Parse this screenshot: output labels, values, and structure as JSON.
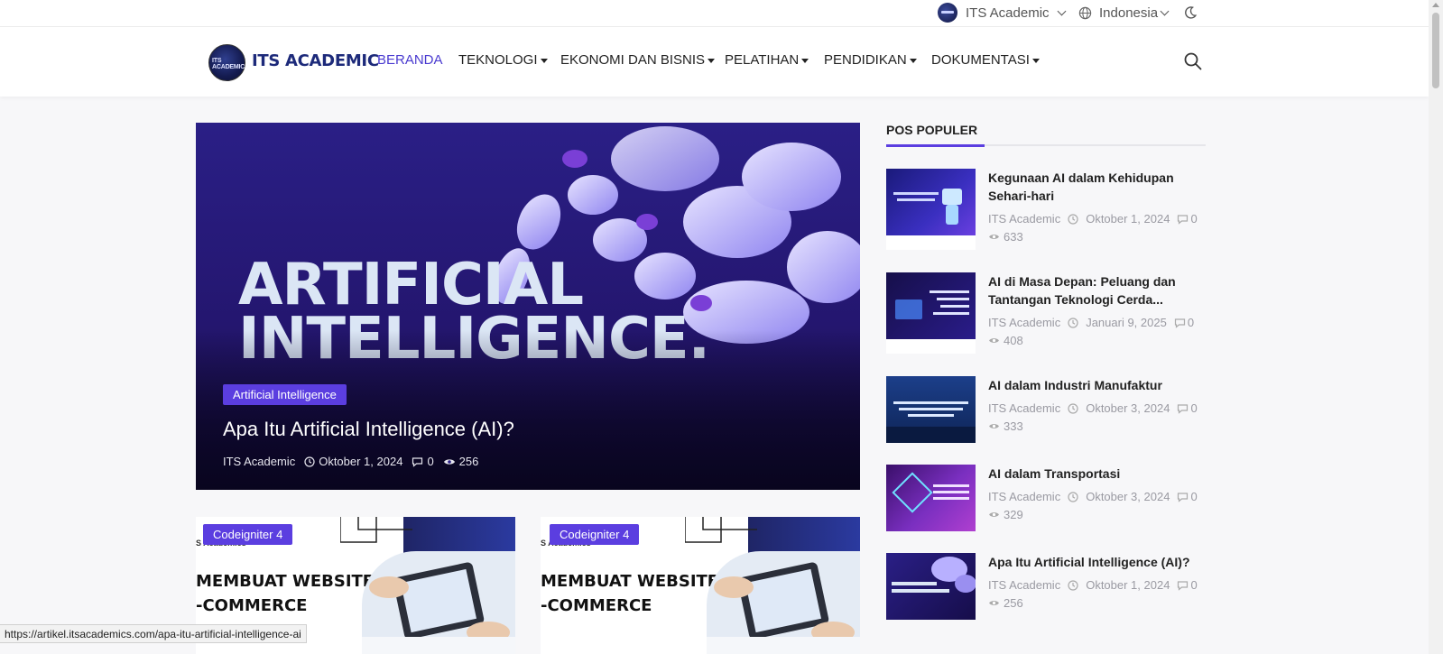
{
  "topbar": {
    "account_label": "ITS Academic",
    "language_label": "Indonesia",
    "theme_icon": "moon-icon"
  },
  "header": {
    "logo_badge_text": "ITS ACADEMIC",
    "logo_text": "ITS ACADEMIC",
    "nav": [
      {
        "label": "BERANDA",
        "dropdown": false
      },
      {
        "label": "TEKNOLOGI",
        "dropdown": true
      },
      {
        "label": "EKONOMI DAN BISNIS",
        "dropdown": true
      },
      {
        "label": "PELATIHAN",
        "dropdown": true
      },
      {
        "label": "PENDIDIKAN",
        "dropdown": true
      },
      {
        "label": "DOKUMENTASI",
        "dropdown": true
      }
    ],
    "search_icon": "search-icon"
  },
  "hero": {
    "image_text_line1": "ARTIFICIAL",
    "image_text_line2": "INTELLIGENCE.",
    "category": "Artificial Intelligence",
    "title": "Apa Itu Artificial Intelligence (AI)?",
    "author": "ITS Academic",
    "date": "Oktober 1, 2024",
    "comments": "0",
    "views": "256"
  },
  "cards": [
    {
      "category": "Codeigniter 4",
      "small_text": "S Academics",
      "big_line1": "MEMBUAT WEBSITE",
      "big_line2": "-COMMERCE"
    },
    {
      "category": "Codeigniter 4",
      "small_text": "S Academics",
      "big_line1": "MEMBUAT WEBSITE",
      "big_line2": "-COMMERCE"
    }
  ],
  "sidebar": {
    "title": "POS POPULER",
    "posts": [
      {
        "title": "Kegunaan AI dalam Kehidupan Sehari-hari",
        "author": "ITS Academic",
        "date": "Oktober 1, 2024",
        "comments": "0",
        "views": "633"
      },
      {
        "title": "AI di Masa Depan: Peluang dan Tantangan Teknologi Cerda...",
        "author": "ITS Academic",
        "date": "Januari 9, 2025",
        "comments": "0",
        "views": "408"
      },
      {
        "title": "AI dalam Industri Manufaktur",
        "author": "ITS Academic",
        "date": "Oktober 3, 2024",
        "comments": "0",
        "views": "333"
      },
      {
        "title": "AI dalam Transportasi",
        "author": "ITS Academic",
        "date": "Oktober 3, 2024",
        "comments": "0",
        "views": "329"
      },
      {
        "title": "Apa Itu Artificial Intelligence (AI)?",
        "author": "ITS Academic",
        "date": "Oktober 1, 2024",
        "comments": "0",
        "views": "256"
      }
    ]
  },
  "status_bar": {
    "url": "https://artikel.itsacademics.com/apa-itu-artificial-intelligence-ai"
  },
  "colors": {
    "accent": "#5b3ee0",
    "nav_active": "#4a3bd0",
    "brand_dark": "#1d2a7a"
  }
}
